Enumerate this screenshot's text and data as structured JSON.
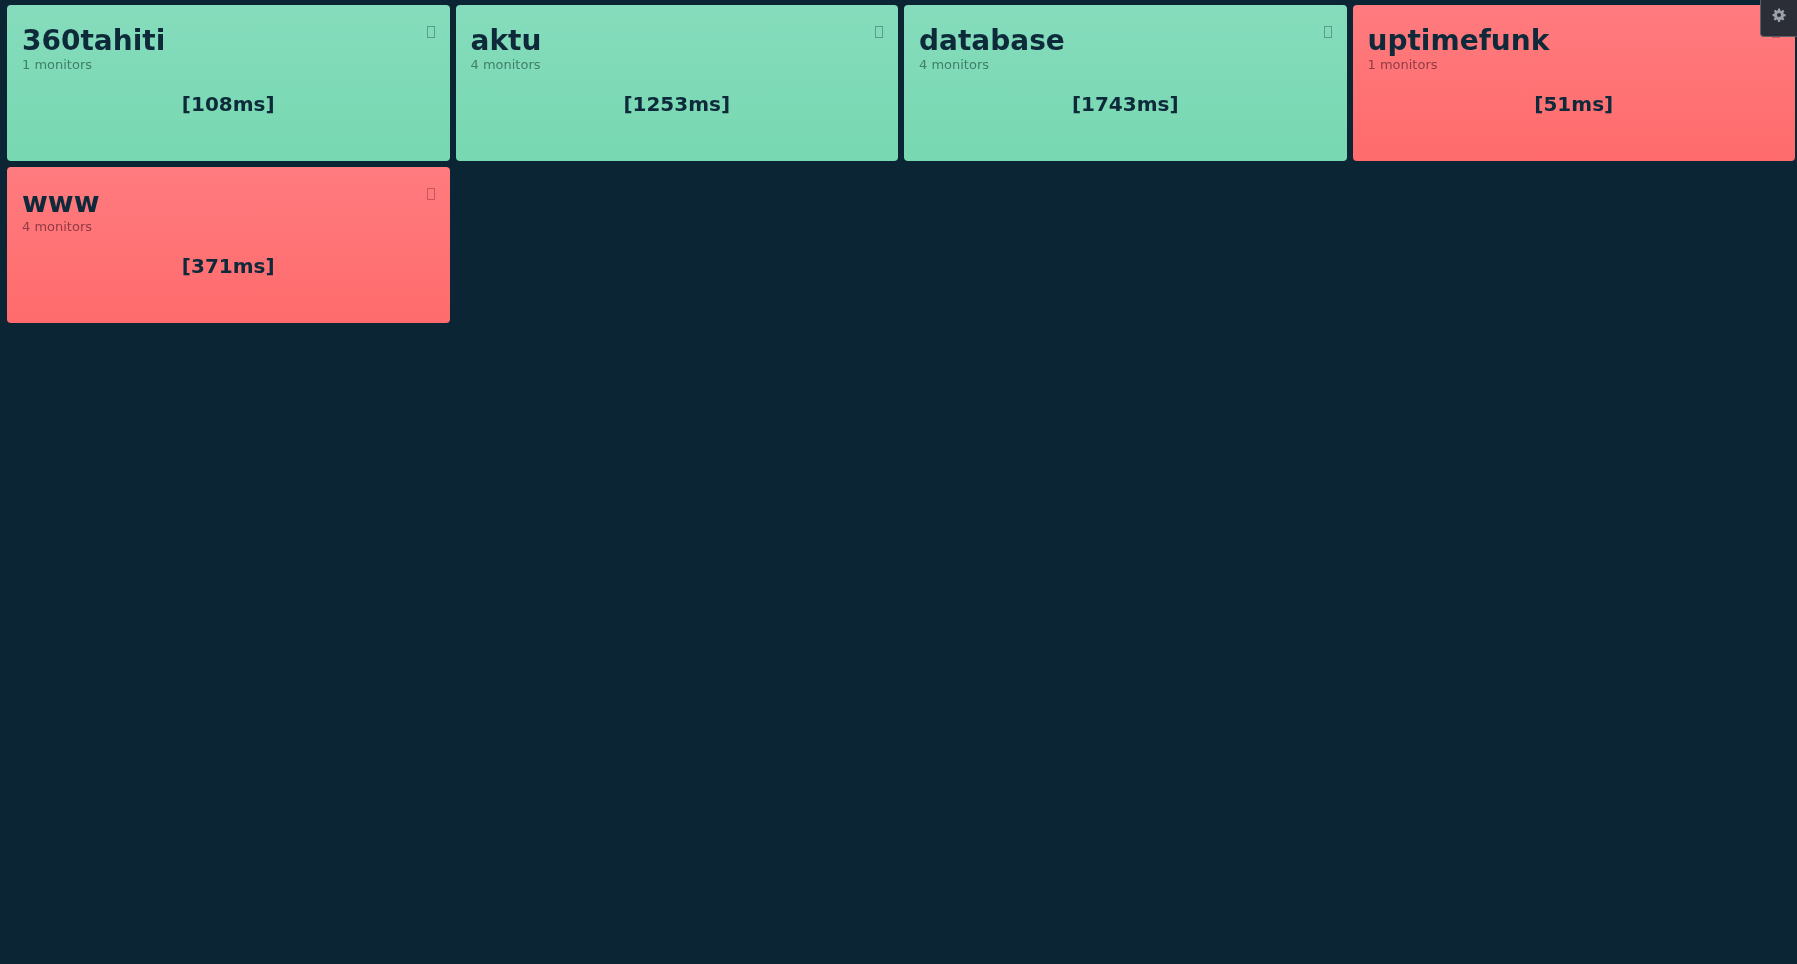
{
  "groups": [
    {
      "name": "360tahiti",
      "monitors": "1 monitors",
      "response": "[108ms]",
      "up": true
    },
    {
      "name": "aktu",
      "monitors": "4 monitors",
      "response": "[1253ms]",
      "up": true
    },
    {
      "name": "database",
      "monitors": "4 monitors",
      "response": "[1743ms]",
      "up": true
    },
    {
      "name": "uptimefunk",
      "monitors": "1 monitors",
      "response": "[51ms]",
      "up": false
    },
    {
      "name": "www",
      "monitors": "4 monitors",
      "response": "[371ms]",
      "up": false
    }
  ]
}
